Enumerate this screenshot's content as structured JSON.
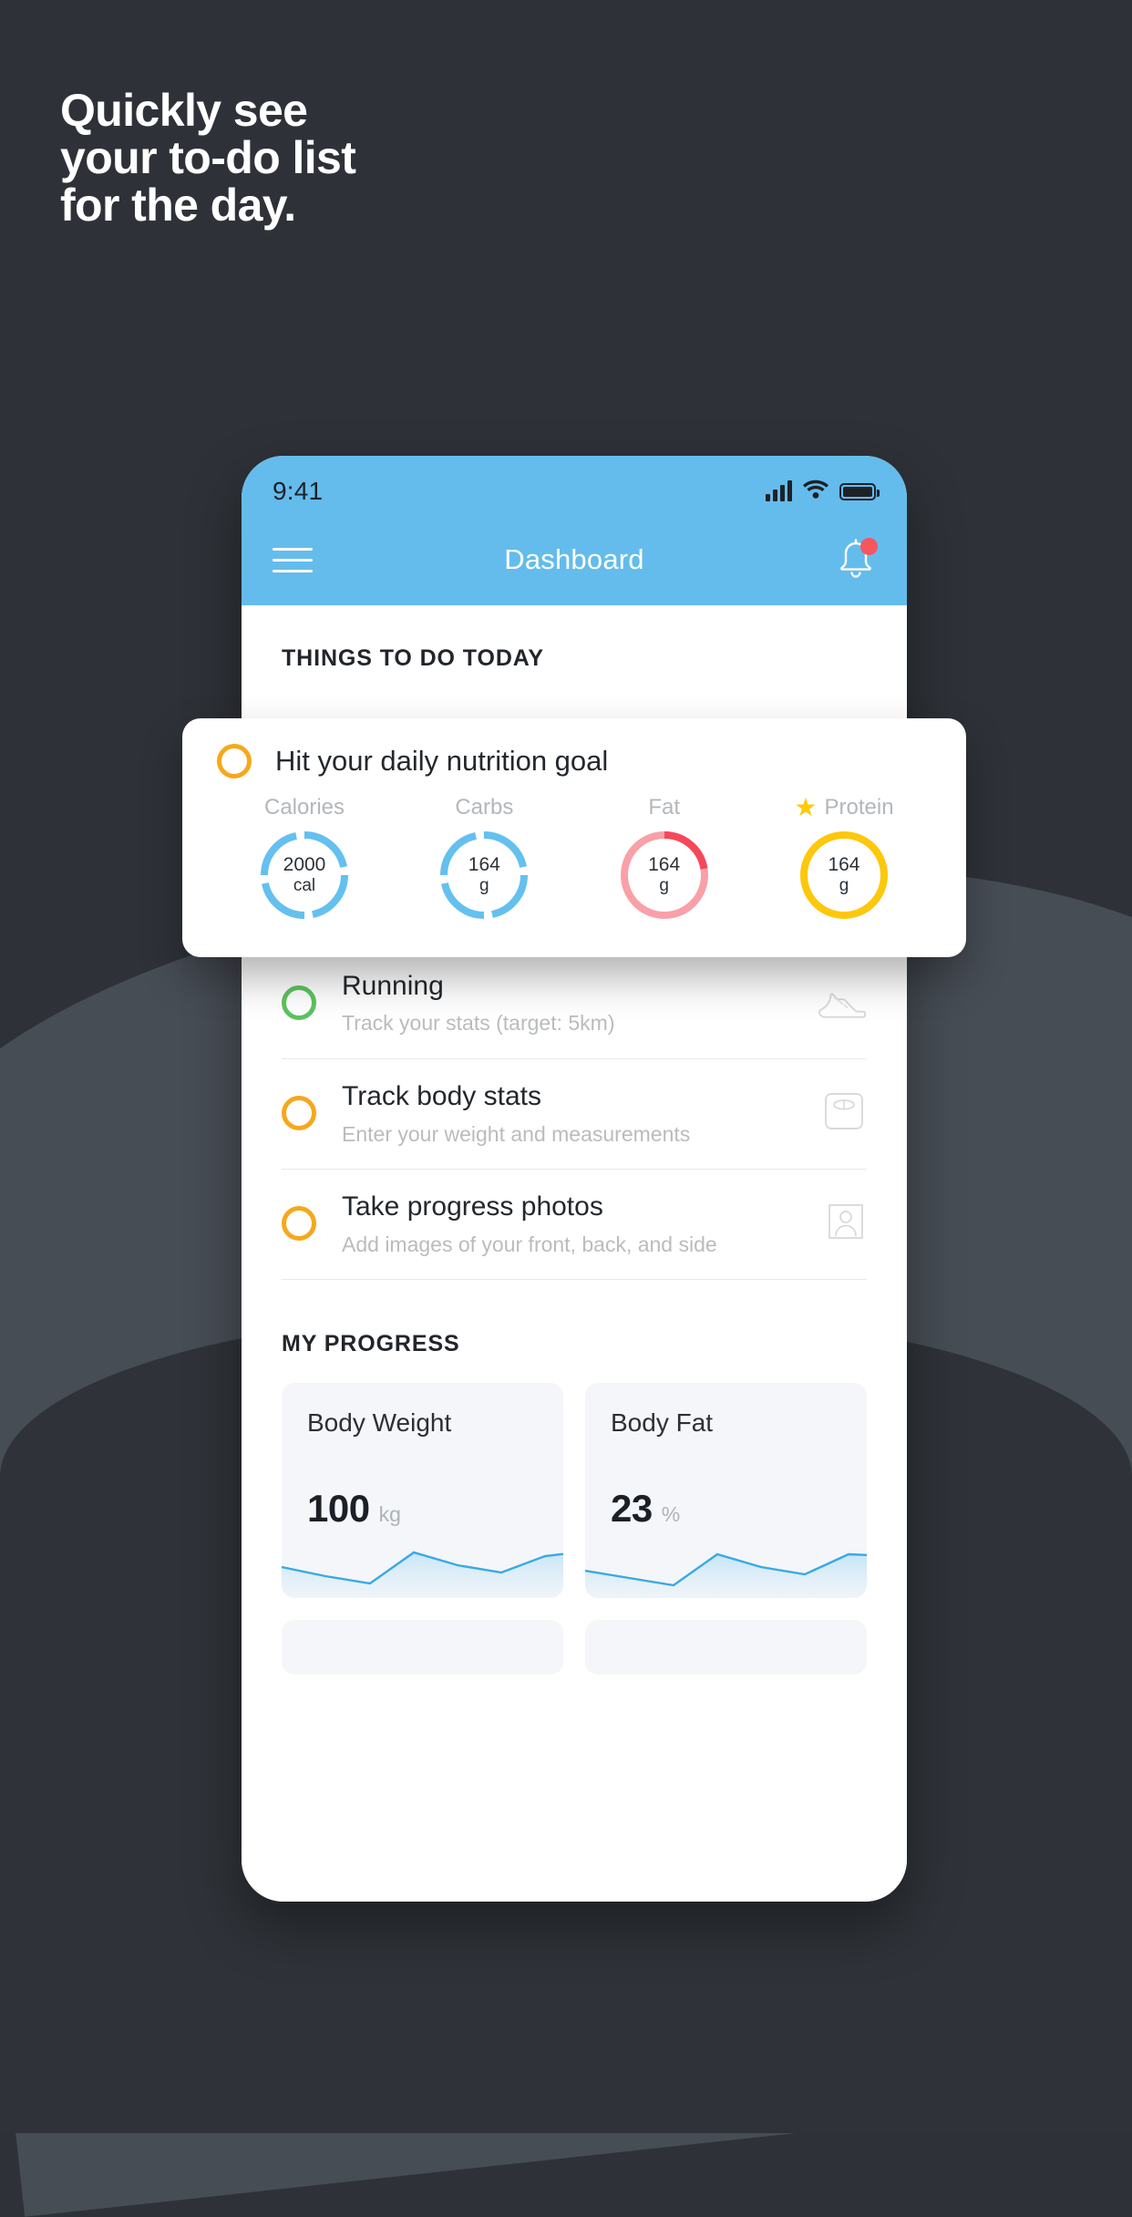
{
  "headline": {
    "lines": [
      "Quickly see",
      "your to-do list",
      "for the day."
    ]
  },
  "colors": {
    "background": "#2e3238",
    "background_band": "#474d55",
    "accent_blue": "#64bcec",
    "accent_yellow": "#f5a81c",
    "accent_green": "#5cc45e",
    "accent_red": "#f8555f",
    "donut_blue": "#64c0ef",
    "donut_pink": "#f9a0a8",
    "donut_red": "#f4495a",
    "donut_yellow": "#fdc70c",
    "star_yellow": "#ffc907"
  },
  "phone": {
    "statusbar": {
      "time": "9:41",
      "signal_icon": "signal-bars-icon",
      "wifi_icon": "wifi-icon",
      "battery_icon": "battery-full-icon"
    },
    "navbar": {
      "menu_icon": "hamburger-menu-icon",
      "title": "Dashboard",
      "notification_icon": "bell-icon",
      "notification_badge": true
    },
    "sections": {
      "todo_heading": "THINGS TO DO TODAY",
      "progress_heading": "MY PROGRESS"
    },
    "todos": [
      {
        "title": "Running",
        "subtitle": "Track your stats (target: 5km)",
        "ring_color": "green",
        "icon": "running-shoe-icon"
      },
      {
        "title": "Track body stats",
        "subtitle": "Enter your weight and measurements",
        "ring_color": "amber",
        "icon": "weight-scale-icon"
      },
      {
        "title": "Take progress photos",
        "subtitle": "Add images of your front, back, and side",
        "ring_color": "amber",
        "icon": "progress-photo-icon"
      }
    ],
    "progress_cards": [
      {
        "title": "Body Weight",
        "value": "100",
        "unit": "kg"
      },
      {
        "title": "Body Fat",
        "value": "23",
        "unit": "%"
      }
    ]
  },
  "nutrition_card": {
    "ring_color": "amber",
    "title": "Hit your daily nutrition goal",
    "macros": [
      {
        "label": "Calories",
        "value": "2000",
        "unit": "cal",
        "starred": false,
        "ring": "blue-segmented",
        "percent": 78
      },
      {
        "label": "Carbs",
        "value": "164",
        "unit": "g",
        "starred": false,
        "ring": "blue-segmented",
        "percent": 78
      },
      {
        "label": "Fat",
        "value": "164",
        "unit": "g",
        "starred": false,
        "ring": "pink-red",
        "percent": 22
      },
      {
        "label": "Protein",
        "value": "164",
        "unit": "g",
        "starred": true,
        "ring": "yellow-solid",
        "percent": 100
      }
    ]
  },
  "chart_data": [
    {
      "type": "area",
      "title": "Body Weight",
      "ylabel": "kg",
      "x": [
        0,
        1,
        2,
        3,
        4,
        5,
        6
      ],
      "values": [
        46,
        34,
        26,
        62,
        48,
        40,
        58,
        66
      ],
      "ylim": [
        0,
        80
      ],
      "grid": false,
      "legend": "none"
    },
    {
      "type": "area",
      "title": "Body Fat",
      "ylabel": "%",
      "x": [
        0,
        1,
        2,
        3,
        4,
        5,
        6
      ],
      "values": [
        42,
        30,
        22,
        60,
        44,
        36,
        58,
        62
      ],
      "ylim": [
        0,
        80
      ],
      "grid": false,
      "legend": "none"
    }
  ]
}
